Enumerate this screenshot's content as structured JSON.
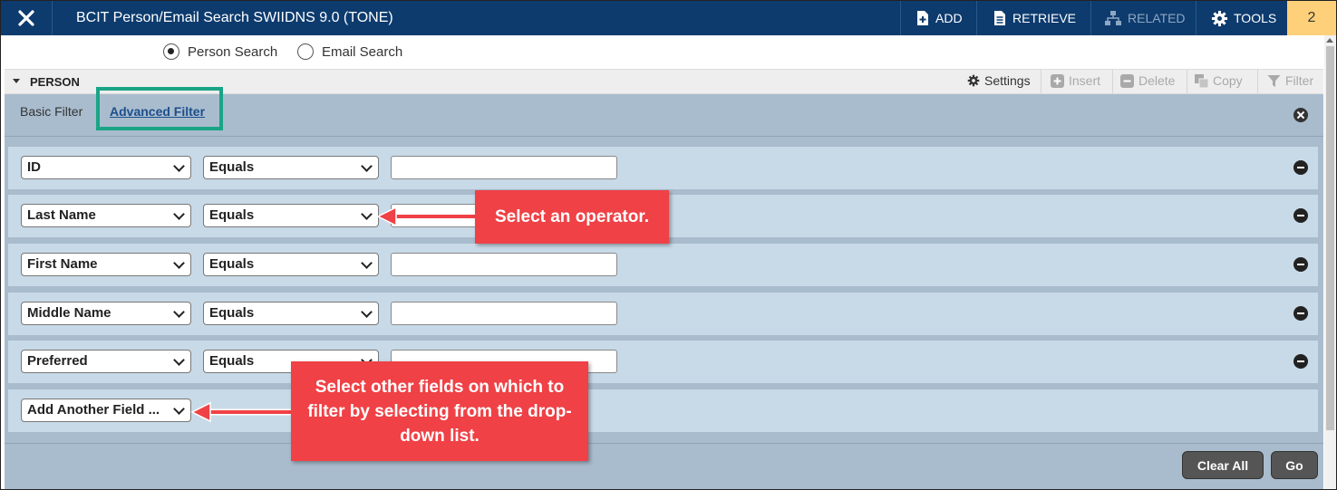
{
  "header": {
    "title": "BCIT Person/Email Search SWIIDNS 9.0 (TONE)",
    "actions": {
      "add": "ADD",
      "retrieve": "RETRIEVE",
      "related": "RELATED",
      "tools": "TOOLS"
    },
    "count": "2"
  },
  "search_mode": {
    "person": "Person Search",
    "email": "Email Search",
    "selected": "person"
  },
  "section": {
    "title": "PERSON",
    "settings": "Settings",
    "insert": "Insert",
    "delete": "Delete",
    "copy": "Copy",
    "filter": "Filter"
  },
  "filter": {
    "basic_tab": "Basic Filter",
    "advanced_tab": "Advanced Filter",
    "rows": [
      {
        "field": "ID",
        "operator": "Equals",
        "value": ""
      },
      {
        "field": "Last Name",
        "operator": "Equals",
        "value": ""
      },
      {
        "field": "First Name",
        "operator": "Equals",
        "value": ""
      },
      {
        "field": "Middle Name",
        "operator": "Equals",
        "value": ""
      },
      {
        "field": "Preferred",
        "operator": "Equals",
        "value": ""
      }
    ],
    "add_field": "Add Another Field ...",
    "clear_all": "Clear All",
    "go": "Go"
  },
  "callouts": {
    "operator": "Select an operator.",
    "fields": "Select other fields on which to filter by selecting from the drop-down list."
  },
  "colors": {
    "topbar": "#0d3b6e",
    "panel": "#a9bccd",
    "row": "#c8dae7",
    "callout": "#ef4146",
    "highlight": "#1aa486",
    "count_badge": "#ffd07a"
  }
}
